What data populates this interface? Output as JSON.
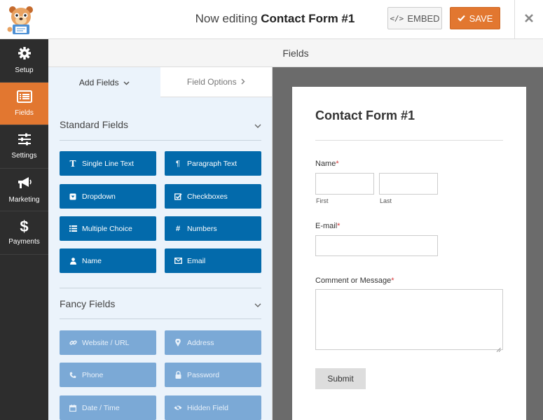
{
  "header": {
    "title_prefix": "Now editing",
    "form_name": "Contact Form #1",
    "embed_label": "EMBED",
    "save_label": "SAVE"
  },
  "sidebar": {
    "items": [
      {
        "label": "Setup",
        "icon": "gear-icon"
      },
      {
        "label": "Fields",
        "icon": "list-icon",
        "active": true
      },
      {
        "label": "Settings",
        "icon": "sliders-icon"
      },
      {
        "label": "Marketing",
        "icon": "megaphone-icon"
      },
      {
        "label": "Payments",
        "icon": "dollar-icon"
      }
    ]
  },
  "section_title": "Fields",
  "panel": {
    "tabs": [
      {
        "label": "Add Fields",
        "active": true
      },
      {
        "label": "Field Options",
        "active": false
      }
    ],
    "standard": {
      "title": "Standard Fields",
      "fields": [
        {
          "label": "Single Line Text",
          "icon": "text-icon"
        },
        {
          "label": "Paragraph Text",
          "icon": "paragraph-icon"
        },
        {
          "label": "Dropdown",
          "icon": "dropdown-icon"
        },
        {
          "label": "Checkboxes",
          "icon": "checkbox-icon"
        },
        {
          "label": "Multiple Choice",
          "icon": "list-icon"
        },
        {
          "label": "Numbers",
          "icon": "hash-icon"
        },
        {
          "label": "Name",
          "icon": "user-icon"
        },
        {
          "label": "Email",
          "icon": "envelope-icon"
        }
      ]
    },
    "fancy": {
      "title": "Fancy Fields",
      "fields": [
        {
          "label": "Website / URL",
          "icon": "link-icon"
        },
        {
          "label": "Address",
          "icon": "map-marker-icon"
        },
        {
          "label": "Phone",
          "icon": "phone-icon"
        },
        {
          "label": "Password",
          "icon": "lock-icon"
        },
        {
          "label": "Date / Time",
          "icon": "calendar-icon"
        },
        {
          "label": "Hidden Field",
          "icon": "eye-slash-icon"
        }
      ]
    }
  },
  "preview": {
    "form_title": "Contact Form #1",
    "name_label": "Name",
    "first_label": "First",
    "last_label": "Last",
    "email_label": "E-mail",
    "comment_label": "Comment or Message",
    "required_mark": "*",
    "submit_label": "Submit"
  },
  "colors": {
    "accent": "#e27730",
    "standard_button": "#036aab",
    "fancy_button": "#7ba9d6",
    "sidebar": "#2d2d2d"
  }
}
